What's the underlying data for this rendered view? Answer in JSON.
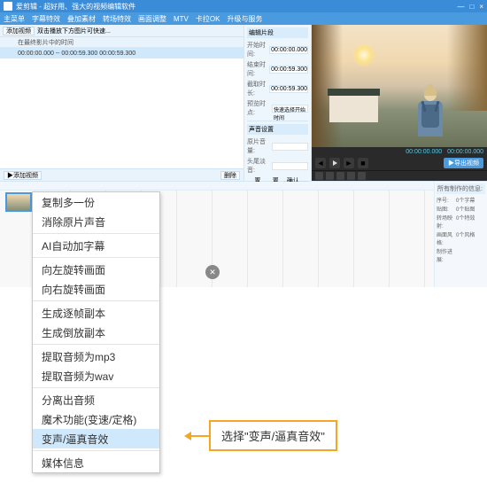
{
  "title": "爱剪辑 - 超好用、强大的视频编辑软件",
  "win_ctrl": [
    "—",
    "□",
    "×"
  ],
  "menu": [
    "主菜单",
    "字幕特效",
    "叠加素材",
    "转场特效",
    "画面调整",
    "MTV",
    "卡拉OK",
    "升级与服务"
  ],
  "list": {
    "toolbar_add": "添加视频",
    "toolbar_tip": "双击播放下方图片可快速...",
    "col_header": "在最终影片中的时间",
    "row1": "00:00:00.000 -- 00:00:59.300  00:00:59.300",
    "btn_add": "▶添加视频",
    "btn_del": "删除"
  },
  "props": {
    "panel_title": "编辑片段",
    "r1l": "开始时间:",
    "r1v": "00:00:00.000",
    "r2l": "结束时间:",
    "r2v": "00:00:59.300",
    "r3l": "截取时长:",
    "r3v": "00:00:59.300",
    "r4l": "预览时点:",
    "r4v": "快速选择开始时间",
    "sec2_title": "声音设置",
    "r5l": "原片音量:",
    "r6l": "头尾淡音:",
    "chk1": "置入",
    "chk2": "置人",
    "btn_confirm": "确认修改"
  },
  "player": {
    "t1": "00:00:00.000",
    "t2": "00:00:00.000",
    "export": "▶导出视频"
  },
  "ctx_items": [
    {
      "t": "复制多一份",
      "sep": false
    },
    {
      "t": "消除原片声音",
      "sep": true
    },
    {
      "t": "AI自动加字幕",
      "sep": true
    },
    {
      "t": "向左旋转画面",
      "sep": false
    },
    {
      "t": "向右旋转画面",
      "sep": true
    },
    {
      "t": "生成逐帧副本",
      "sep": false
    },
    {
      "t": "生成倒放副本",
      "sep": true
    },
    {
      "t": "提取音频为mp3",
      "sep": false
    },
    {
      "t": "提取音频为wav",
      "sep": true
    },
    {
      "t": "分离出音频",
      "sep": false
    },
    {
      "t": "魔术功能(变速/定格)",
      "sep": false
    },
    {
      "t": "变声/逼真音效",
      "sep": true,
      "sel": true
    },
    {
      "t": "媒体信息",
      "sep": false
    }
  ],
  "timeline_side": {
    "title": "所有制作的信息:",
    "r1l": "序号:",
    "r1v": "0个字幕",
    "r2l": "贴图:",
    "r2v": "0个贴图",
    "r3l": "转场映射:",
    "r3v": "0个特效",
    "r4l": "画面风格:",
    "r4v": "0个风格",
    "r5l": "制作进展:",
    "r5v": ""
  },
  "callout_text": "选择\"变声/逼真音效\""
}
